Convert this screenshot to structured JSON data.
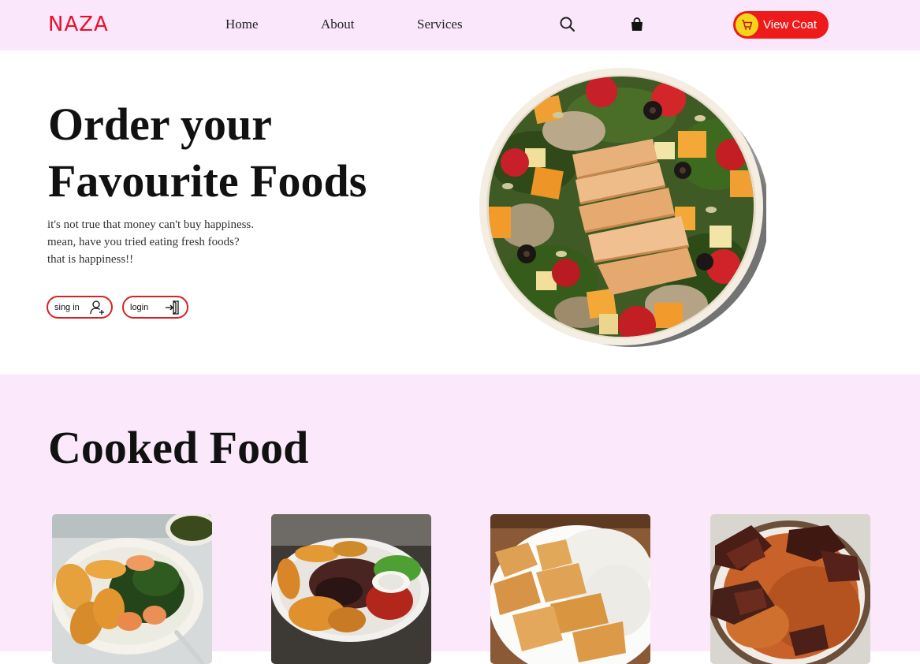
{
  "header": {
    "logo": "NAZA",
    "nav": {
      "home": "Home",
      "about": "About",
      "services": "Services"
    },
    "icons": [
      "search-icon",
      "shopping-bag-icon",
      "cart-icon"
    ],
    "view_cart_label": "View Coat"
  },
  "hero": {
    "title_line1": "Order your",
    "title_line2": "Favourite Foods",
    "description": [
      "it's not true that money can't buy happiness.",
      "mean, have you tried eating fresh foods?",
      "that is happiness!!"
    ],
    "signin_label": "sing in",
    "login_label": "login"
  },
  "cooked_section": {
    "title": "Cooked Food"
  },
  "colors": {
    "brand_red": "#e8112d",
    "button_red": "#ef1a1a",
    "cart_yellow": "#f5d51c",
    "header_bg": "#fbe7fb",
    "section_bg": "#fbe9fb"
  }
}
